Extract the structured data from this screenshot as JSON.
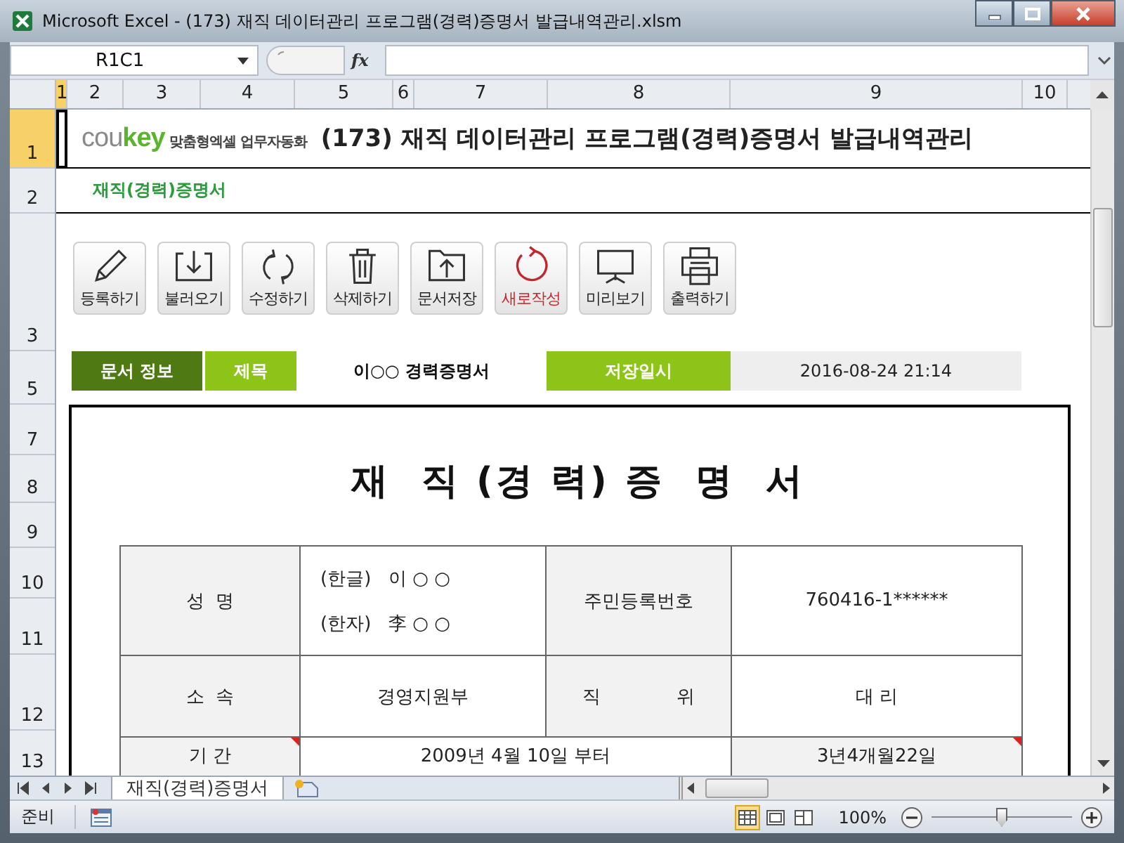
{
  "window": {
    "title": "Microsoft Excel - (173) 재직 데이터관리 프로그램(경력)증명서 발급내역관리.xlsm"
  },
  "formula_bar": {
    "name_box": "R1C1",
    "fx": "fx"
  },
  "column_headers": [
    {
      "label": "1",
      "selected": true
    },
    {
      "label": "2",
      "selected": false
    },
    {
      "label": "3",
      "selected": false
    },
    {
      "label": "4",
      "selected": false
    },
    {
      "label": "5",
      "selected": false
    },
    {
      "label": "6",
      "selected": false
    },
    {
      "label": "7",
      "selected": false
    },
    {
      "label": "8",
      "selected": false
    },
    {
      "label": "9",
      "selected": false
    },
    {
      "label": "10",
      "selected": false
    }
  ],
  "row_headers": [
    {
      "label": "1",
      "selected": true
    },
    {
      "label": "2",
      "selected": false
    },
    {
      "label": "3",
      "selected": false
    },
    {
      "label": "5",
      "selected": false
    },
    {
      "label": "7",
      "selected": false
    },
    {
      "label": "8",
      "selected": false
    },
    {
      "label": "9",
      "selected": false
    },
    {
      "label": "10",
      "selected": false
    },
    {
      "label": "11",
      "selected": false
    },
    {
      "label": "12",
      "selected": false
    },
    {
      "label": "13",
      "selected": false
    }
  ],
  "logo": {
    "brand_a": "cou",
    "brand_b": "key",
    "tagline": "맞춤형엑셀 업무자동화"
  },
  "sheet_title": "(173) 재직 데이터관리 프로그램(경력)증명서 발급내역관리",
  "subtitle": "재직(경력)증명서",
  "toolbar": [
    {
      "label": "등록하기",
      "color": "#222222"
    },
    {
      "label": "불러오기",
      "color": "#222222"
    },
    {
      "label": "수정하기",
      "color": "#222222"
    },
    {
      "label": "삭제하기",
      "color": "#222222"
    },
    {
      "label": "문서저장",
      "color": "#222222"
    },
    {
      "label": "새로작성",
      "color": "#c0282d"
    },
    {
      "label": "미리보기",
      "color": "#222222"
    },
    {
      "label": "출력하기",
      "color": "#222222"
    }
  ],
  "info_bar": [
    {
      "kind": "header",
      "text": "문서 정보"
    },
    {
      "kind": "label",
      "text": "제목"
    },
    {
      "kind": "value",
      "text": "이○○ 경력증명서"
    },
    {
      "kind": "label",
      "text": "저장일시"
    },
    {
      "kind": "date",
      "text": "2016-08-24 21:14"
    }
  ],
  "certificate": {
    "title": "재  직 (경 력) 증  명  서",
    "rows": [
      [
        {
          "kind": "head",
          "lines": [
            "성  명"
          ]
        },
        {
          "kind": "value",
          "lines": [
            "(한글)   이 ○ ○",
            "(한자)   李 ○ ○"
          ]
        },
        {
          "kind": "head",
          "lines": [
            "주민등록번호"
          ]
        },
        {
          "kind": "value",
          "lines": [
            "760416-1******"
          ]
        }
      ],
      [
        {
          "kind": "head",
          "lines": [
            "소  속"
          ]
        },
        {
          "kind": "value",
          "lines": [
            "경영지원부"
          ]
        },
        {
          "kind": "head",
          "lines": [
            "직             위"
          ]
        },
        {
          "kind": "value",
          "lines": [
            "대 리"
          ]
        }
      ],
      [
        {
          "kind": "head",
          "lines": [
            "기 간"
          ],
          "comment": true
        },
        {
          "kind": "value",
          "lines": [
            "2009년 4월 10일 부터"
          ]
        },
        "",
        {
          "kind": "head",
          "lines": [
            "3년4개월22일"
          ],
          "comment": true
        }
      ]
    ]
  },
  "sheet_tabs": [
    {
      "label": "재직(경력)증명서",
      "selected": true
    }
  ],
  "status_bar": {
    "mode": "준비",
    "views": [
      {
        "selected": true
      },
      {
        "selected": false
      },
      {
        "selected": false
      }
    ],
    "zoom": "100%",
    "level": 0.5
  }
}
